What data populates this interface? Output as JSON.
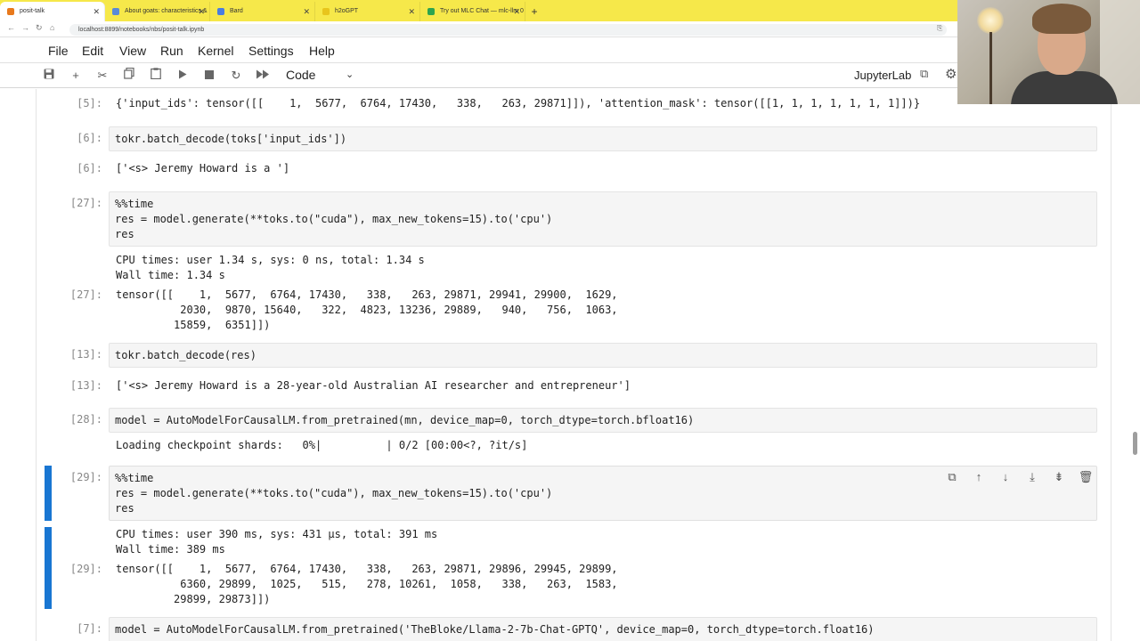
{
  "browser": {
    "tabs": [
      {
        "label": "posit-talk",
        "active": true
      },
      {
        "label": "About goats: characteristics &",
        "active": false
      },
      {
        "label": "Bard",
        "active": false
      },
      {
        "label": "h2oGPT",
        "active": false
      },
      {
        "label": "Try out MLC Chat — mlc-llm 0",
        "active": false
      }
    ],
    "url": "localhost:8899/notebooks/nbs/posit-talk.ipynb"
  },
  "menus": [
    "File",
    "Edit",
    "View",
    "Run",
    "Kernel",
    "Settings",
    "Help"
  ],
  "toolbar": {
    "cell_type": "Code",
    "jupyterlab_label": "JupyterLab"
  },
  "cells": [
    {
      "id": "c5",
      "prompt": "[5]:",
      "output": "{'input_ids': tensor([[    1,  5677,  6764, 17430,   338,   263, 29871]]), 'attention_mask': tensor([[1, 1, 1, 1, 1, 1, 1]])}"
    },
    {
      "id": "c6",
      "in_prompt": "[6]:",
      "code": "tokr.batch_decode(toks['input_ids'])",
      "out_prompt": "[6]:",
      "output": "['<s> Jeremy Howard is a ']"
    },
    {
      "id": "c27",
      "in_prompt": "[27]:",
      "code_lines": [
        "%%time",
        "res = model.generate(**toks.to(\"cuda\"), max_new_tokens=15).to('cpu')",
        "res"
      ],
      "stream": [
        "CPU times: user 1.34 s, sys: 0 ns, total: 1.34 s",
        "Wall time: 1.34 s"
      ],
      "out_prompt": "[27]:",
      "output_lines": [
        "tensor([[    1,  5677,  6764, 17430,   338,   263, 29871, 29941, 29900,  1629,",
        "          2030,  9870, 15640,   322,  4823, 13236, 29889,   940,   756,  1063,",
        "         15859,  6351]])"
      ]
    },
    {
      "id": "c13",
      "in_prompt": "[13]:",
      "code": "tokr.batch_decode(res)",
      "out_prompt": "[13]:",
      "output": "['<s> Jeremy Howard is a 28-year-old Australian AI researcher and entrepreneur']"
    },
    {
      "id": "c28",
      "in_prompt": "[28]:",
      "code": "model = AutoModelForCausalLM.from_pretrained(mn, device_map=0, torch_dtype=torch.bfloat16)",
      "stream": "Loading checkpoint shards:   0%|          | 0/2 [00:00<?, ?it/s]"
    },
    {
      "id": "c29",
      "in_prompt": "[29]:",
      "code_lines": [
        "%%time",
        "res = model.generate(**toks.to(\"cuda\"), max_new_tokens=15).to('cpu')",
        "res"
      ],
      "stream": [
        "CPU times: user 390 ms, sys: 431 µs, total: 391 ms",
        "Wall time: 389 ms"
      ],
      "out_prompt": "[29]:",
      "output_lines": [
        "tensor([[    1,  5677,  6764, 17430,   338,   263, 29871, 29896, 29945, 29899,",
        "          6360, 29899,  1025,   515,   278, 10261,  1058,   338,   263,  1583,",
        "         29899, 29873]])"
      ]
    },
    {
      "id": "c7",
      "in_prompt": "[7]:",
      "code": "model = AutoModelForCausalLM.from_pretrained('TheBloke/Llama-2-7b-Chat-GPTQ', device_map=0, torch_dtype=torch.float16)"
    }
  ],
  "icons": {
    "toolbar": [
      "save-icon",
      "add-cell-icon",
      "cut-icon",
      "copy-icon",
      "paste-icon",
      "run-icon",
      "stop-icon",
      "restart-icon",
      "run-all-icon"
    ],
    "cell_toolbar": [
      "duplicate-icon",
      "move-up-icon",
      "move-down-icon",
      "insert-below-icon",
      "merge-icon",
      "delete-icon"
    ]
  },
  "colors": {
    "tabbar": "#f6e84a",
    "selection_bar": "#1976d2"
  }
}
